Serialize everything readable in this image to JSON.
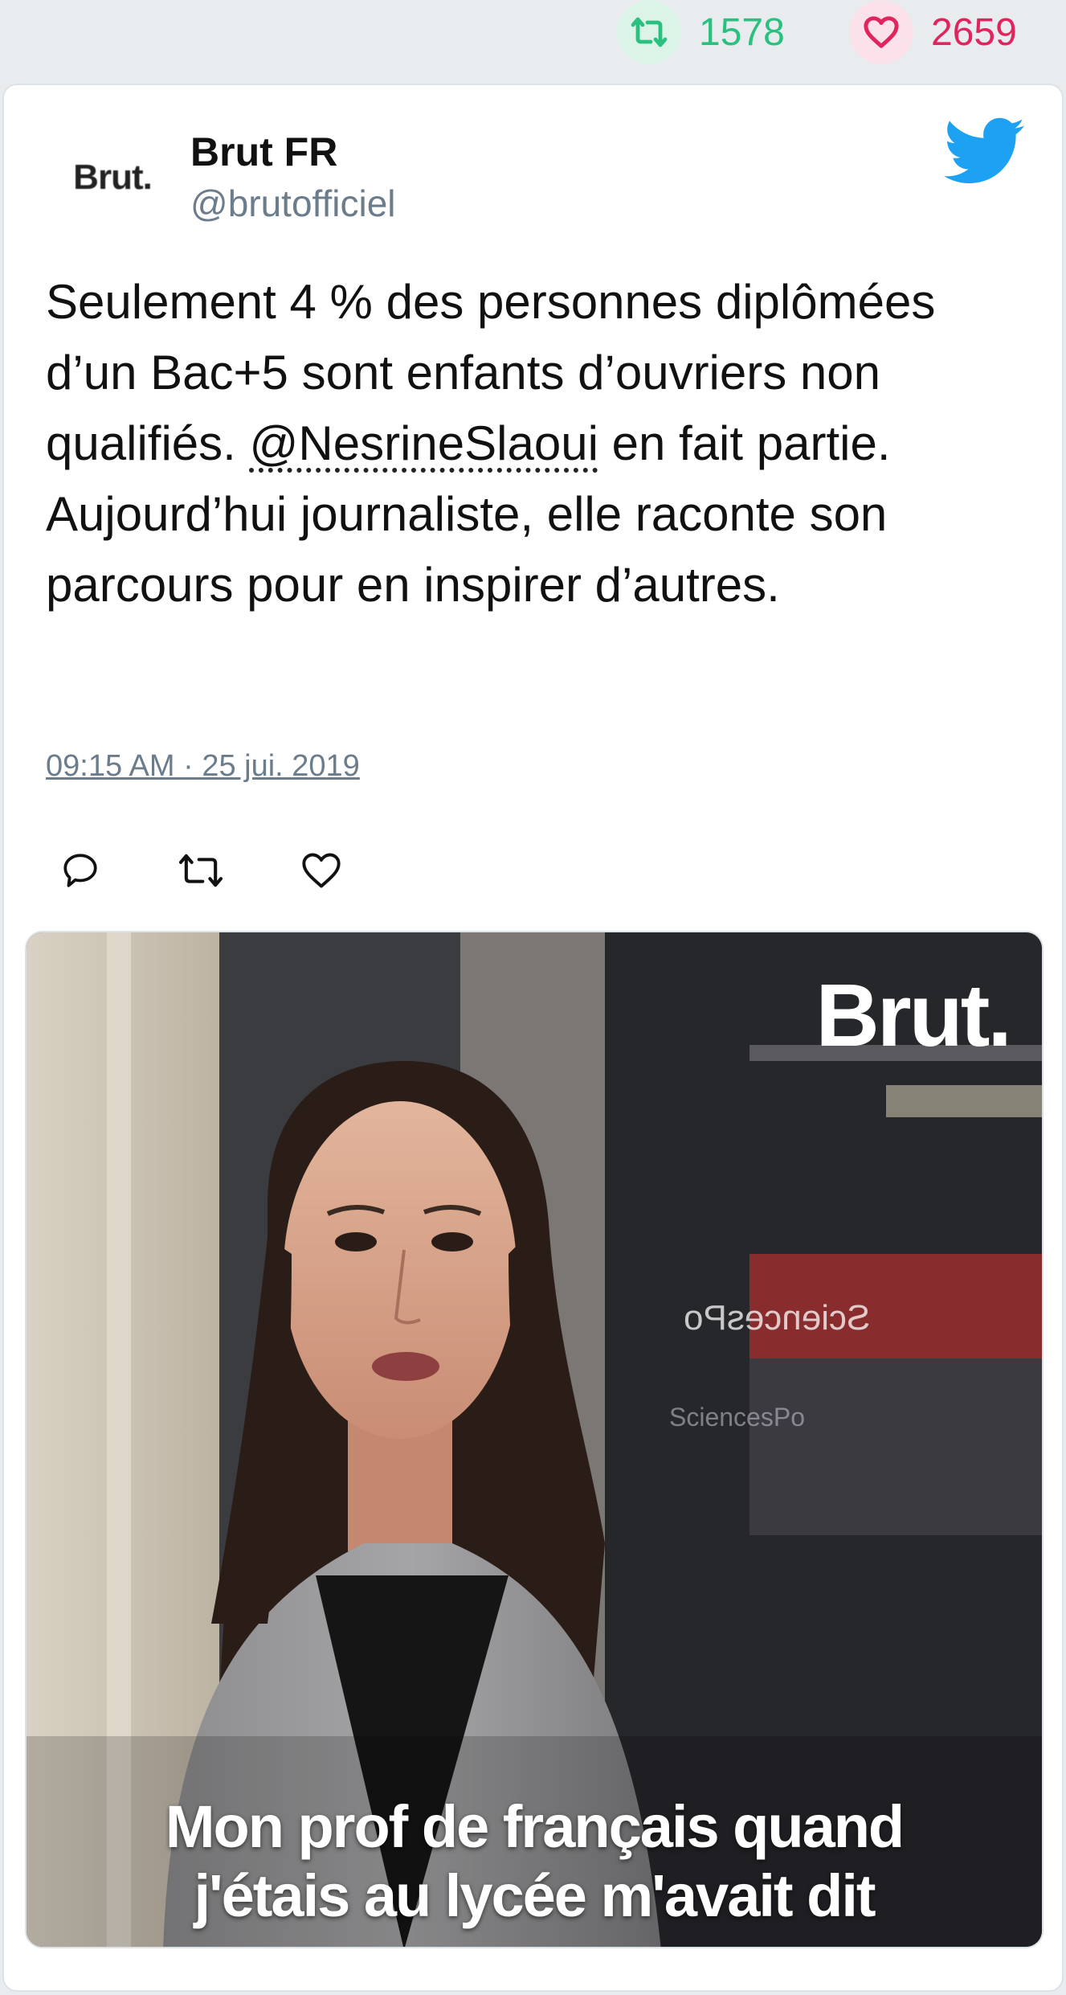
{
  "stats": {
    "retweets": "1578",
    "likes": "2659"
  },
  "author": {
    "avatar_text": "Brut.",
    "name": "Brut FR",
    "handle": "@brutofficiel"
  },
  "tweet": {
    "text_before": "Seulement 4 % des personnes diplômées d’un Bac+5 sont enfants d’ouvriers non qualifiés. ",
    "mention": "@NesrineSlaoui",
    "text_after": " en fait partie. Aujourd’hui journaliste, elle raconte son parcours pour en inspirer d’autres.",
    "timestamp": "09:15 AM · 25 jui. 2019"
  },
  "media": {
    "watermark": "Brut.",
    "caption_line1": "Mon prof de français quand",
    "caption_line2": "j'étais au lycée m'avait dit",
    "sign_text": "SciencesPo",
    "sign_text2": "SciencesPo"
  },
  "icons": {
    "retweet": "retweet-icon",
    "like": "heart-icon",
    "reply": "reply-icon",
    "twitter": "twitter-bird-icon"
  },
  "colors": {
    "retweet": "#2cc080",
    "like": "#e0245e",
    "twitter": "#1da1f2",
    "muted": "#6b7c8c"
  }
}
